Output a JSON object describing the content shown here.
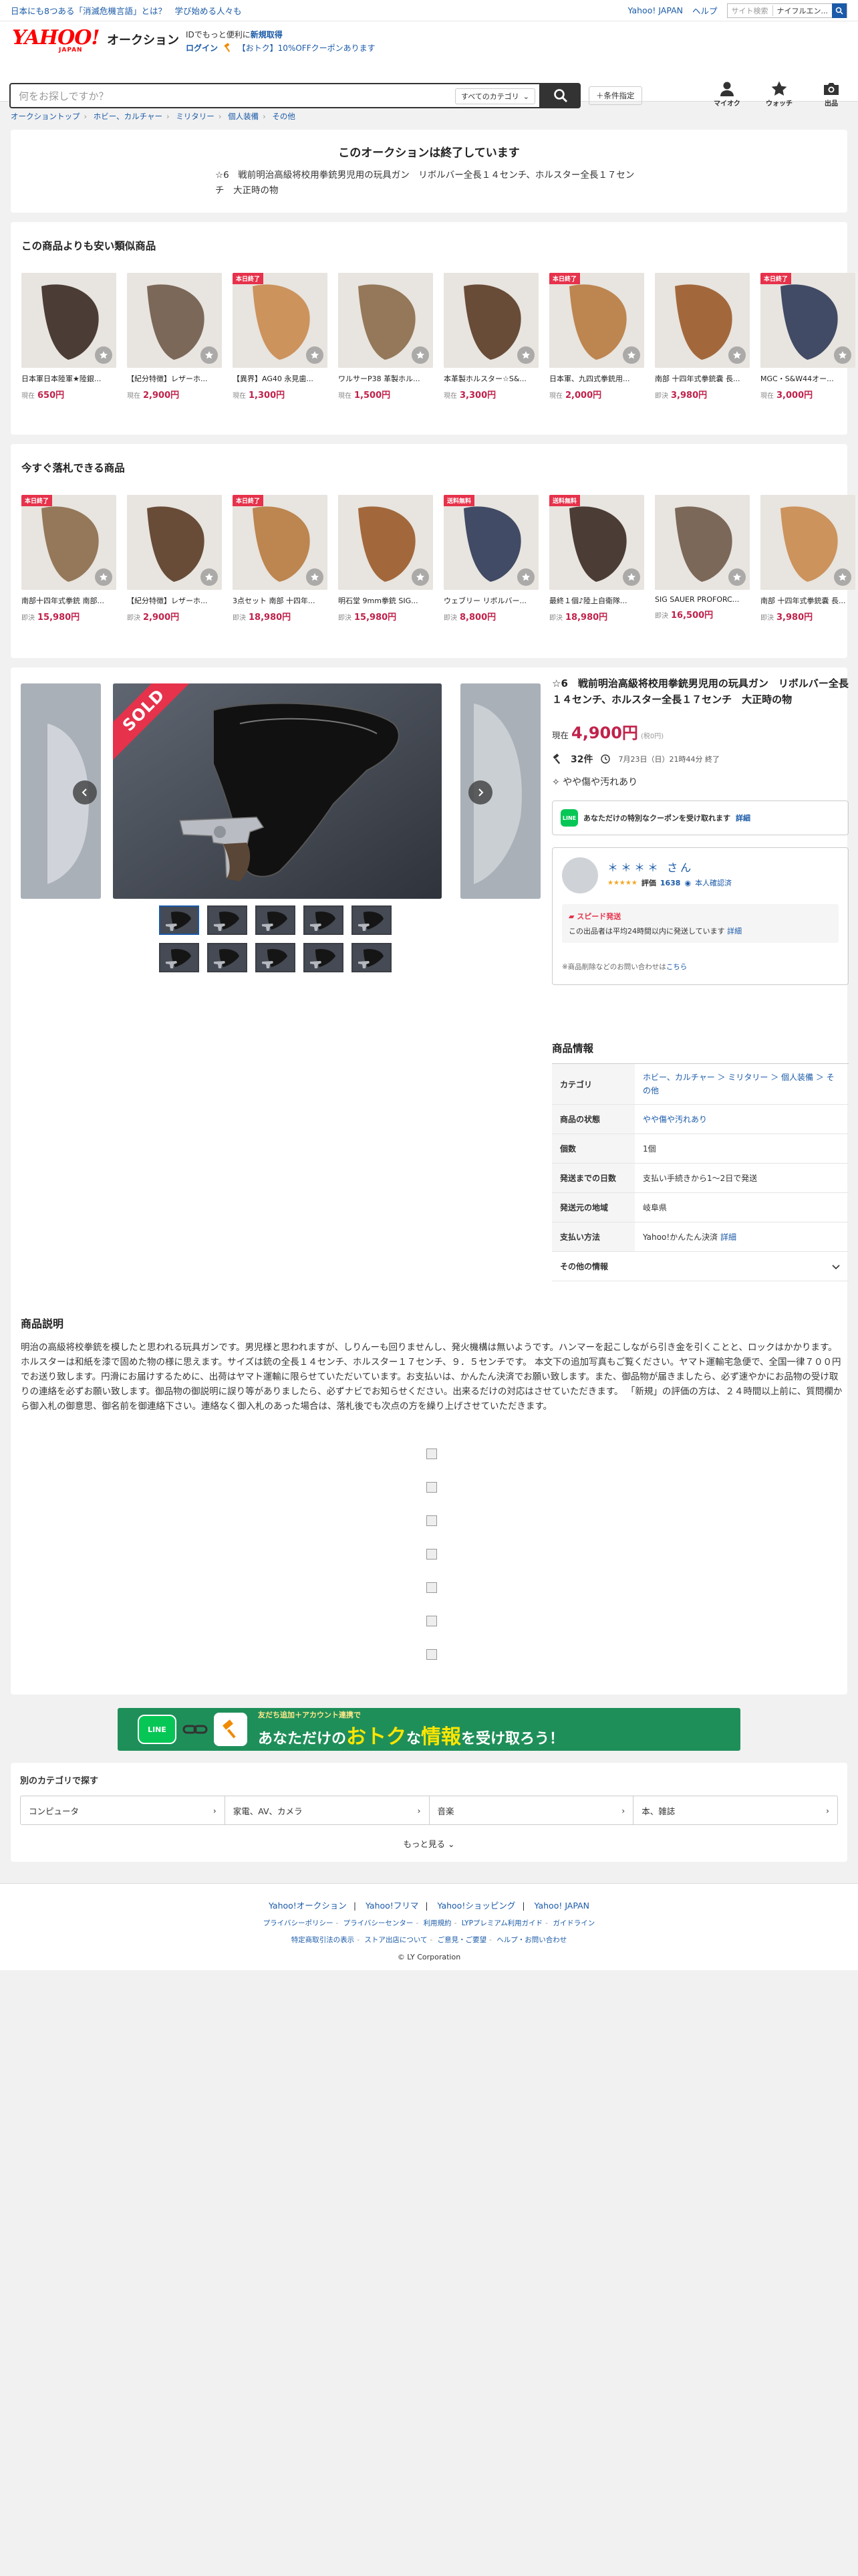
{
  "topbar": {
    "promo": "日本にも8つある「消滅危機言語」とは？　学び始める人々も",
    "yahoo_japan": "Yahoo! JAPAN",
    "help": "ヘルプ",
    "search_placeholder": "サイト検索",
    "search_select": "ナイフルエン..."
  },
  "header": {
    "logo_text": "YAHOO!",
    "logo_sub": "JAPAN",
    "service": "オークション",
    "id_text": "IDでもっと便利に",
    "signup": "新規取得",
    "login": "ログイン",
    "coupon": "【おトク】10%OFFクーポンあります",
    "search_placeholder": "何をお探しですか？",
    "category_select": "すべてのカテゴリ",
    "advanced": "＋条件指定",
    "icons": [
      {
        "label": "マイオク"
      },
      {
        "label": "ウォッチ"
      },
      {
        "label": "出品"
      }
    ]
  },
  "breadcrumb": [
    "オークショントップ",
    "ホビー、カルチャー",
    "ミリタリー",
    "個人装備",
    "その他"
  ],
  "ended": {
    "heading": "このオークションは終了しています",
    "title": "☆6　戦前明治高級将校用拳銃男児用の玩具ガン　リボルバー全長１４センチ、ホルスター全長１７センチ　大正時の物"
  },
  "cheap": {
    "title": "この商品よりも安い類似商品",
    "items": [
      {
        "name": "日本軍日本陸軍★陸銀...",
        "label": "現在",
        "price": "650円",
        "badge": ""
      },
      {
        "name": "【紀分特徴】レザーホ...",
        "label": "現在",
        "price": "2,900円",
        "badge": ""
      },
      {
        "name": "【異界】AG40 永見歯...",
        "label": "現在",
        "price": "1,300円",
        "badge": "本日終了"
      },
      {
        "name": "ワルサーP38 革製ホル...",
        "label": "現在",
        "price": "1,500円",
        "badge": ""
      },
      {
        "name": "本革製ホルスター☆S&...",
        "label": "現在",
        "price": "3,300円",
        "badge": ""
      },
      {
        "name": "日本軍、九四式拳銃用...",
        "label": "現在",
        "price": "2,000円",
        "badge": "本日終了"
      },
      {
        "name": "南部 十四年式拳銃嚢 長...",
        "label": "即決",
        "price": "3,980円",
        "badge": ""
      },
      {
        "name": "MGC・S&W44オー...",
        "label": "現在",
        "price": "3,000円",
        "badge": "本日終了"
      }
    ]
  },
  "buynow": {
    "title": "今すぐ落札できる商品",
    "items": [
      {
        "name": "南部十四年式拳銃 南部...",
        "label": "即決",
        "price": "15,980円",
        "badge": "本日終了"
      },
      {
        "name": "【紀分特徴】レザーホ...",
        "label": "即決",
        "price": "2,900円",
        "badge": ""
      },
      {
        "name": "3点セット 南部 十四年...",
        "label": "即決",
        "price": "18,980円",
        "badge": "本日終了"
      },
      {
        "name": "明石堂 9mm拳銃 SIG...",
        "label": "即決",
        "price": "15,980円",
        "badge": ""
      },
      {
        "name": "ウェブリー リボルバー...",
        "label": "即決",
        "price": "8,800円",
        "badge": "送料無料"
      },
      {
        "name": "最終１個♪陸上自衛隊...",
        "label": "即決",
        "price": "18,980円",
        "badge": "送料無料"
      },
      {
        "name": "SIG SAUER PROFORC...",
        "label": "即決",
        "price": "16,500円",
        "badge": ""
      },
      {
        "name": "南部 十四年式拳銃嚢 長...",
        "label": "即決",
        "price": "3,980円",
        "badge": ""
      }
    ]
  },
  "item": {
    "sold": "SOLD",
    "title": "☆6　戦前明治高級将校用拳銃男児用の玩具ガン　リボルバー全長１４センチ、ホルスター全長１７センチ　大正時の物",
    "price_label": "現在",
    "price": "4,900円",
    "tax": "(税0円)",
    "bids": "32件",
    "end_time": "7月23日（日）21時44分 終了",
    "condition": "やや傷や汚れあり",
    "coupon": "あなただけの特別なクーポンを受け取れます",
    "coupon_link": "詳細",
    "seller_name": "＊＊＊＊ さん",
    "seller_stars": "★★★★★",
    "rating_label": "評価",
    "rating_count": "1638",
    "verified": "本人確認済",
    "speed_label": "スピード発送",
    "speed_text": "この出品者は平均24時間以内に発送しています",
    "speed_link": "詳細",
    "contact_note": "※商品削除などのお問い合わせは",
    "contact_link": "こちら"
  },
  "info": {
    "title": "商品情報",
    "rows": [
      {
        "k": "カテゴリ",
        "v": "ホビー、カルチャー ＞ ミリタリー ＞ 個人装備 ＞ その他"
      },
      {
        "k": "商品の状態",
        "v": "やや傷や汚れあり"
      },
      {
        "k": "個数",
        "v": "1個"
      },
      {
        "k": "発送までの日数",
        "v": "支払い手続きから1〜2日で発送"
      },
      {
        "k": "発送元の地域",
        "v": "岐阜県"
      },
      {
        "k": "支払い方法",
        "v": "Yahoo!かんたん決済",
        "link": "詳細"
      }
    ],
    "other": "その他の情報"
  },
  "desc": {
    "title": "商品説明",
    "text": "明治の高級将校拳銃を模したと思われる玩具ガンです。男児様と思われますが、しりんーも回りませんし、発火機構は無いようです。ハンマーを起こしながら引き金を引くことと、ロックはかかります。ホルスターは和紙を漆で固めた物の様に思えます。サイズは銃の全長１４センチ、ホルスター１７センチ、９．５センチです。 本文下の追加写真もご覧ください。ヤマト運輸宅急便で、全国一律７００円でお送り致します。円滑にお届けするために、出荷はヤマト運輸に限らせていただいています。お支払いは、かんたん決済でお願い致します。また、御品物が届きましたら、必ず速やかにお品物の受け取りの連絡を必ずお願い致します。御品物の御説明に誤り等がありましたら、必ずナビでお知らせください。出来るだけの対応はさせていただきます。 「新規」の評価の方は、２４時間以上前に、質問欄から御入札の御意思、御名前を御連絡下さい。連絡なく御入札のあった場合は、落札後でも次点の方を繰り上げさせていただきます。"
  },
  "banner": {
    "mini": "友だち追加＋アカウント連携で",
    "lead": "あなただけの",
    "hl1": "おトク",
    "mid": "な",
    "hl2": "情報",
    "tail": "を受け取ろう！"
  },
  "categories": {
    "title": "別のカテゴリで探す",
    "items": [
      "コンピュータ",
      "家電、AV、カメラ",
      "音楽",
      "本、雑誌"
    ],
    "more": "もっと見る"
  },
  "footer": {
    "links1": [
      "Yahoo!オークション",
      "Yahoo!フリマ",
      "Yahoo!ショッピング",
      "Yahoo! JAPAN"
    ],
    "links2": [
      "プライバシーポリシー",
      "プライバシーセンター",
      "利用規約",
      "LYPプレミアム利用ガイド",
      "ガイドライン"
    ],
    "links3": [
      "特定商取引法の表示",
      "ストア出店について",
      "ご意見・ご要望",
      "ヘルプ・お問い合わせ"
    ],
    "copyright": "© LY Corporation"
  },
  "colors": {
    "accent": "#1a5aa8",
    "price": "#c0224b",
    "badge": "#e6324b",
    "logo": "#ff0000",
    "line": "#06c755"
  }
}
